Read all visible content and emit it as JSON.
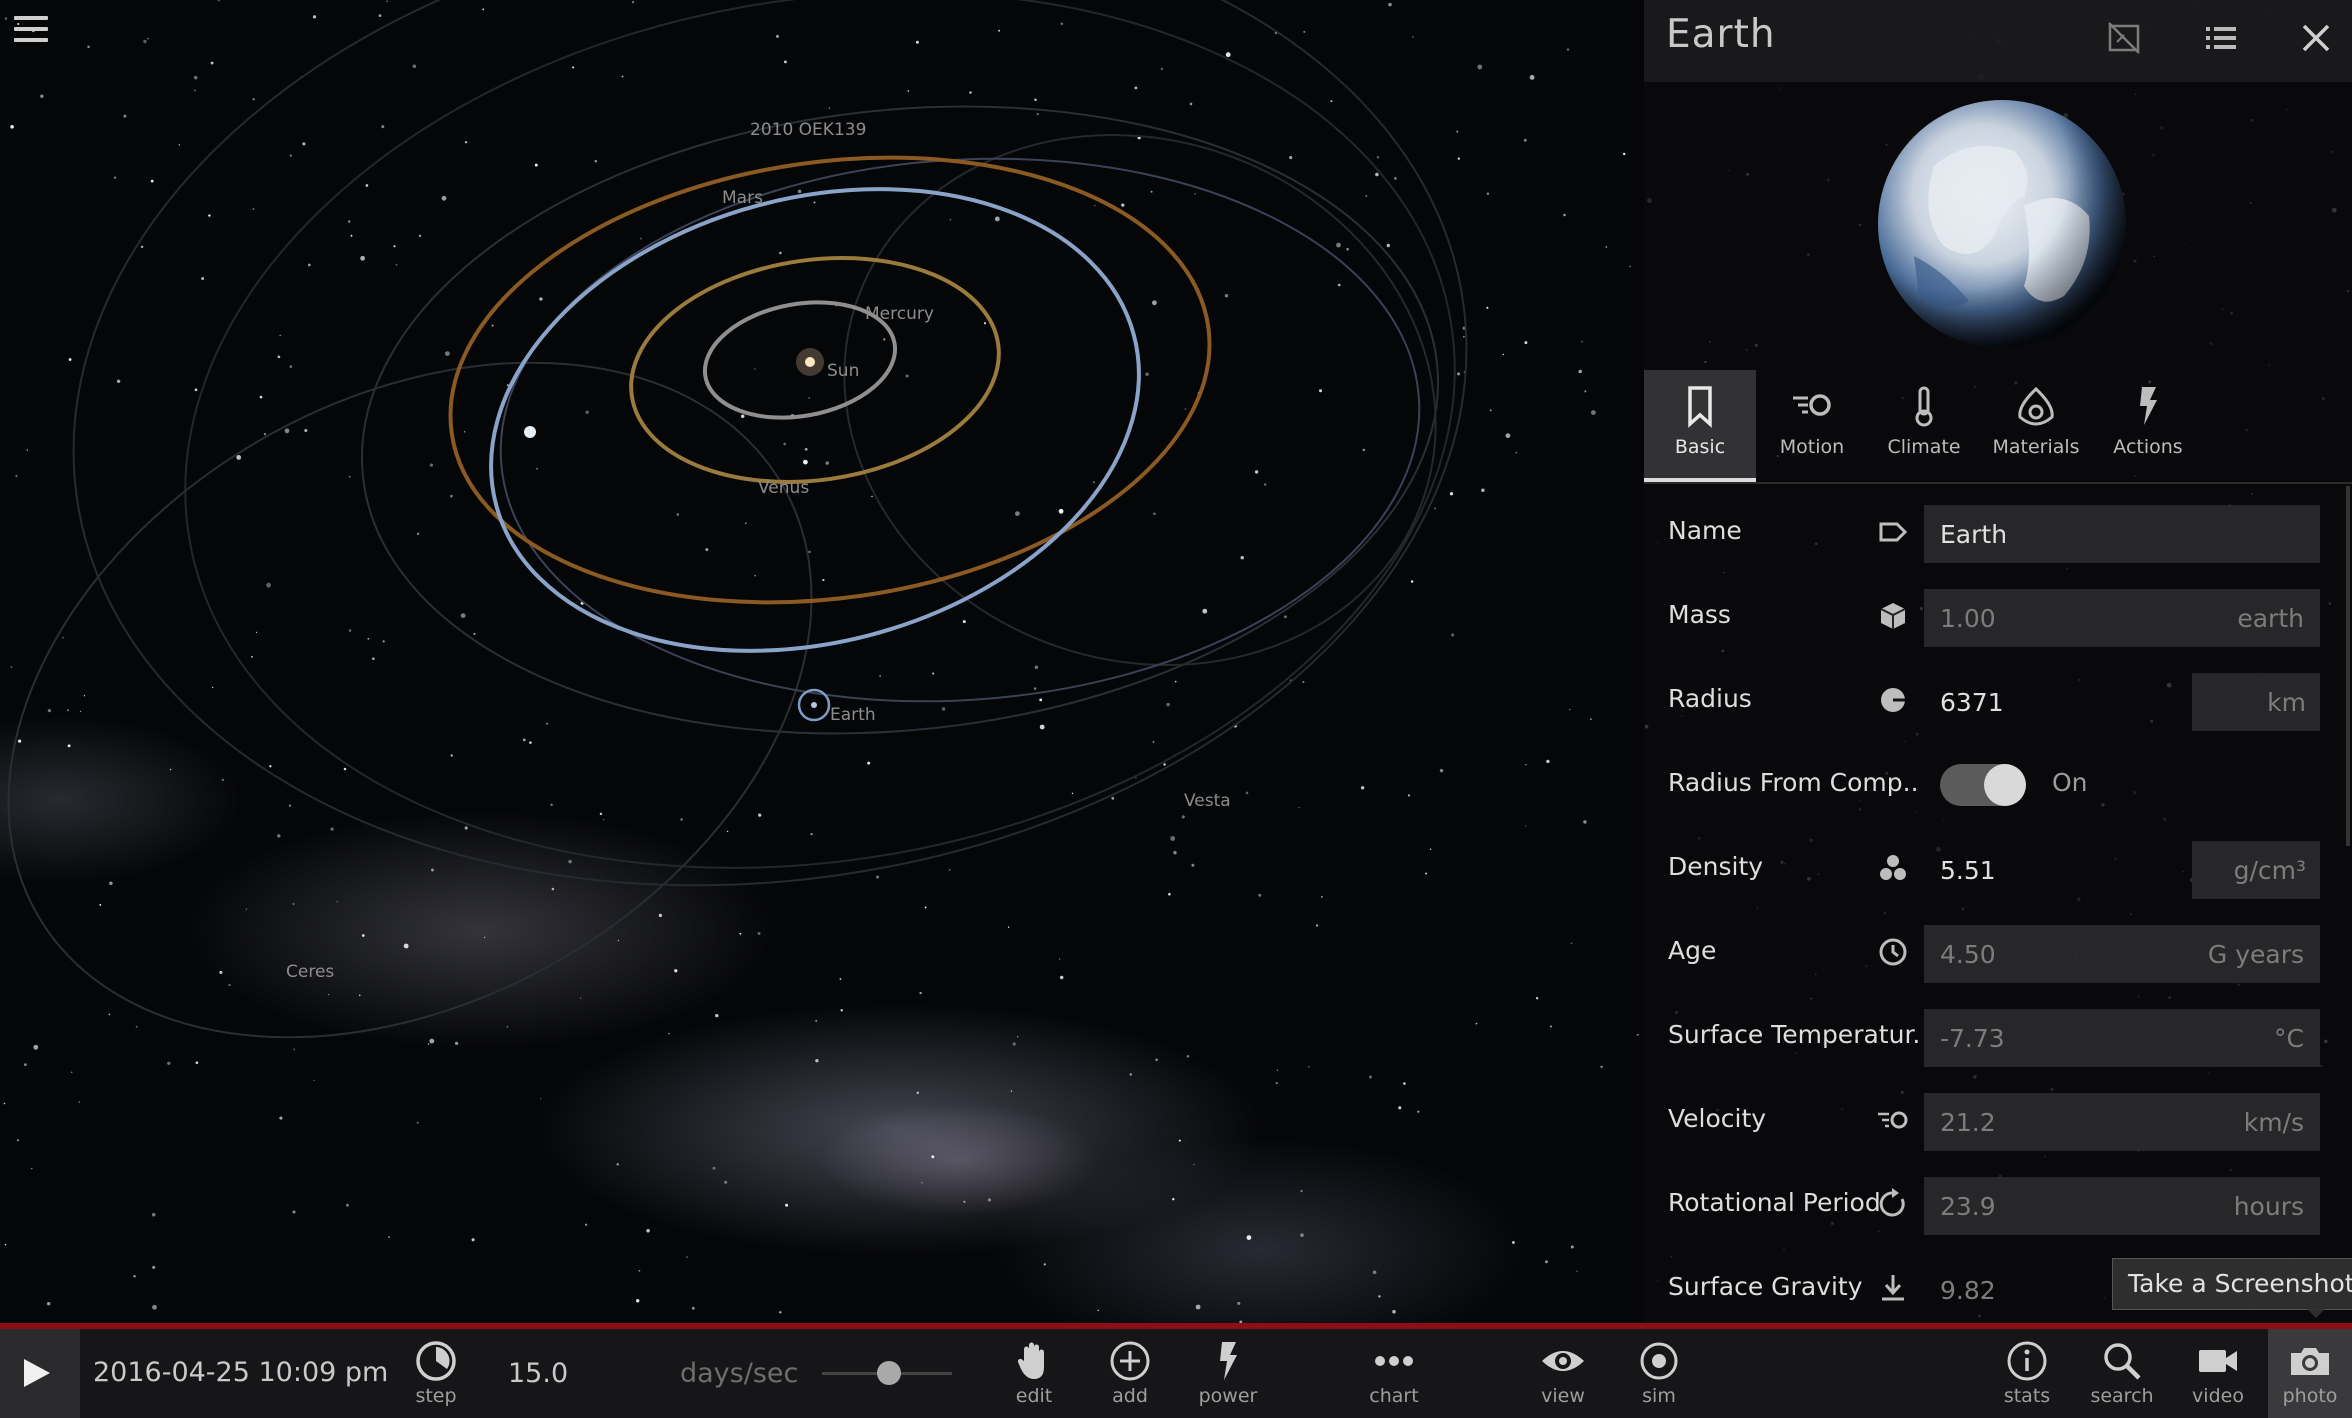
{
  "app": {
    "accent_color": "#8c0f16"
  },
  "viewport": {
    "labels": {
      "asteroid": "2010 OEK139",
      "mars": "Mars",
      "mercury": "Mercury",
      "sun": "Sun",
      "venus": "Venus",
      "earth": "Earth",
      "vesta": "Vesta",
      "ceres": "Ceres"
    }
  },
  "panel": {
    "title": "Earth",
    "header_icons": [
      "no-screenshot-icon",
      "list-icon",
      "close-icon"
    ],
    "tabs": [
      {
        "label": "Basic",
        "icon": "bookmark-icon",
        "active": true
      },
      {
        "label": "Motion",
        "icon": "motion-icon",
        "active": false
      },
      {
        "label": "Climate",
        "icon": "thermometer-icon",
        "active": false
      },
      {
        "label": "Materials",
        "icon": "materials-icon",
        "active": false
      },
      {
        "label": "Actions",
        "icon": "lightning-icon",
        "active": false
      }
    ],
    "properties": {
      "name": {
        "label": "Name",
        "value": "Earth"
      },
      "mass": {
        "label": "Mass",
        "value": "1.00",
        "unit": "earth"
      },
      "radius": {
        "label": "Radius",
        "value": "6371",
        "unit": "km"
      },
      "radius_from_comp": {
        "label": "Radius From Comp...",
        "state": "On",
        "on": true
      },
      "density": {
        "label": "Density",
        "value": "5.51",
        "unit": "g/cm³"
      },
      "age": {
        "label": "Age",
        "value": "4.50",
        "unit": "G years"
      },
      "surface_temperature": {
        "label": "Surface Temperatur...",
        "value": "-7.73",
        "unit": "°C"
      },
      "velocity": {
        "label": "Velocity",
        "value": "21.2",
        "unit": "km/s"
      },
      "rotational_period": {
        "label": "Rotational Period",
        "value": "23.9",
        "unit": "hours"
      },
      "surface_gravity": {
        "label": "Surface Gravity",
        "value": "9.82"
      }
    }
  },
  "tooltip": {
    "text": "Take a Screenshot"
  },
  "toolbar": {
    "datetime": "2016-04-25 10:09 pm",
    "step_label": "step",
    "rate_value": "15.0",
    "rate_unit": "days/sec",
    "tools_center": [
      {
        "label": "edit",
        "icon": "hand-icon"
      },
      {
        "label": "add",
        "icon": "plus-circle-icon"
      },
      {
        "label": "power",
        "icon": "lightning-icon"
      },
      {
        "label": "chart",
        "icon": "dots-icon"
      },
      {
        "label": "view",
        "icon": "eye-icon"
      },
      {
        "label": "sim",
        "icon": "target-icon"
      }
    ],
    "tools_right": [
      {
        "label": "stats",
        "icon": "info-icon"
      },
      {
        "label": "search",
        "icon": "magnifier-icon"
      },
      {
        "label": "video",
        "icon": "video-camera-icon"
      },
      {
        "label": "photo",
        "icon": "camera-icon"
      }
    ]
  }
}
